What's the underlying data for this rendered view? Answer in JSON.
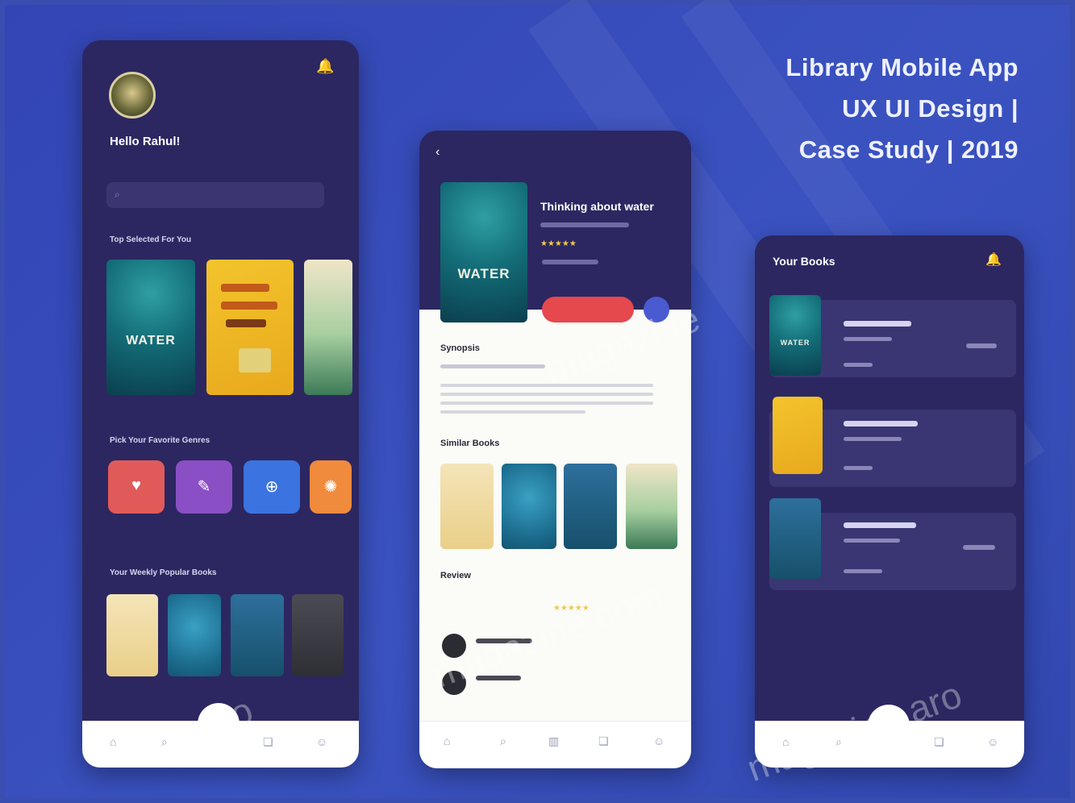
{
  "headline": {
    "line1": "Library Mobile App",
    "line2": "UX UI Design |",
    "line3": "Case Study | 2019"
  },
  "phone1": {
    "greeting": "Hello Rahul!",
    "section_top": "Top Selected For You",
    "section_categories": "Pick Your Favorite Genres",
    "section_popular": "Your Weekly Popular Books",
    "water_cover": "WATER"
  },
  "phone2": {
    "book_title": "Thinking about water",
    "water_cover": "WATER",
    "synopsis_heading": "Synopsis",
    "similar_heading": "Similar Books",
    "review_heading": "Review"
  },
  "phone3": {
    "title": "Your Books",
    "water_cover": "WATER"
  },
  "watermarks": [
    "magazine",
    "magazine.com",
    "eine.aro",
    "magazine.aro"
  ],
  "colors": {
    "background": "#3a4db0",
    "phone_dark": "#2c2761",
    "accent_red": "#e5484d",
    "text_light": "#eef1ff"
  },
  "icons": [
    "bell-icon",
    "back-arrow-icon",
    "home-icon",
    "search-icon",
    "book-icon",
    "profile-icon",
    "bookmark-icon"
  ]
}
